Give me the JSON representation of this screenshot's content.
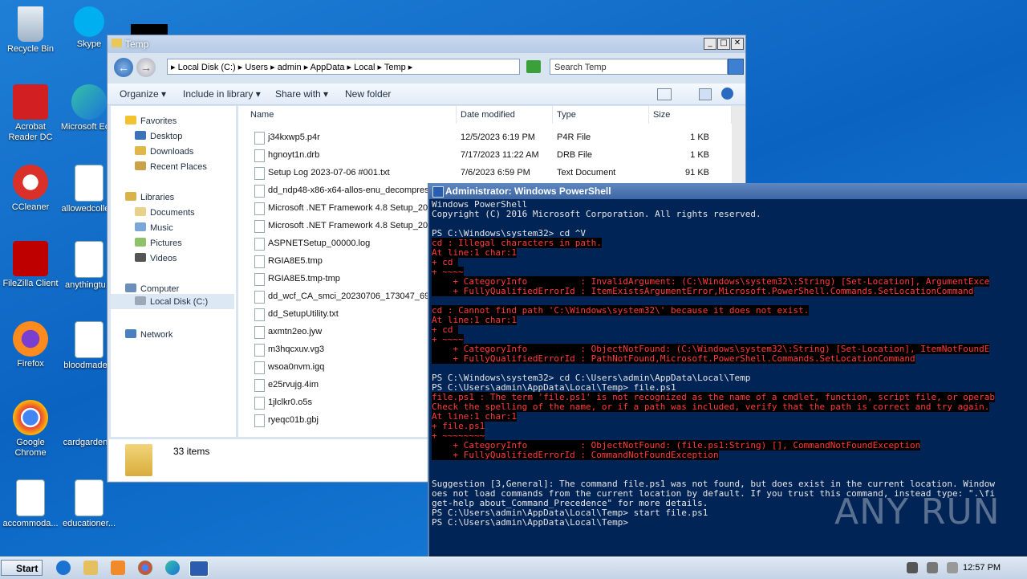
{
  "desktop": {
    "icons": [
      {
        "label": "Recycle Bin"
      },
      {
        "label": "Skype"
      },
      {
        "label": "Acrobat Reader DC"
      },
      {
        "label": "Microsoft Ed..."
      },
      {
        "label": "CCleaner"
      },
      {
        "label": "allowedcolle..."
      },
      {
        "label": "FileZilla Client"
      },
      {
        "label": "anythingtu..."
      },
      {
        "label": "Firefox"
      },
      {
        "label": "bloodmade..."
      },
      {
        "label": "Google Chrome"
      },
      {
        "label": "cardgarden..."
      },
      {
        "label": "accommoda..."
      },
      {
        "label": "educationer..."
      }
    ]
  },
  "explorer": {
    "title": "Temp",
    "address": "▸ Local Disk (C:) ▸ Users ▸ admin ▸ AppData ▸ Local ▸ Temp ▸",
    "search_placeholder": "Search Temp",
    "toolbar": {
      "organize": "Organize ▾",
      "include": "Include in library ▾",
      "share": "Share with ▾",
      "new_folder": "New folder"
    },
    "nav": {
      "favorites": "Favorites",
      "desktop": "Desktop",
      "downloads": "Downloads",
      "recent": "Recent Places",
      "libraries": "Libraries",
      "documents": "Documents",
      "music": "Music",
      "pictures": "Pictures",
      "videos": "Videos",
      "computer": "Computer",
      "localdisk": "Local Disk (C:)",
      "network": "Network"
    },
    "columns": {
      "name": "Name",
      "date": "Date modified",
      "type": "Type",
      "size": "Size"
    },
    "files": [
      {
        "name": "j34kxwp5.p4r",
        "date": "12/5/2023 6:19 PM",
        "type": "P4R File",
        "size": "1 KB"
      },
      {
        "name": "hgnoyt1n.drb",
        "date": "7/17/2023 11:22 AM",
        "type": "DRB File",
        "size": "1 KB"
      },
      {
        "name": "Setup Log 2023-07-06 #001.txt",
        "date": "7/6/2023 6:59 PM",
        "type": "Text Document",
        "size": "91 KB"
      },
      {
        "name": "dd_ndp48-x86-x64-allos-enu_decompres",
        "date": "",
        "type": "",
        "size": ""
      },
      {
        "name": "Microsoft .NET Framework 4.8 Setup_202",
        "date": "",
        "type": "",
        "size": ""
      },
      {
        "name": "Microsoft .NET Framework 4.8 Setup_202",
        "date": "",
        "type": "",
        "size": ""
      },
      {
        "name": "ASPNETSetup_00000.log",
        "date": "",
        "type": "",
        "size": ""
      },
      {
        "name": "RGIA8E5.tmp",
        "date": "",
        "type": "",
        "size": ""
      },
      {
        "name": "RGIA8E5.tmp-tmp",
        "date": "",
        "type": "",
        "size": ""
      },
      {
        "name": "dd_wcf_CA_smci_20230706_173047_693",
        "date": "",
        "type": "",
        "size": ""
      },
      {
        "name": "dd_SetupUtility.txt",
        "date": "",
        "type": "",
        "size": ""
      },
      {
        "name": "axmtn2eo.jyw",
        "date": "",
        "type": "",
        "size": ""
      },
      {
        "name": "m3hqcxuv.vg3",
        "date": "",
        "type": "",
        "size": ""
      },
      {
        "name": "wsoa0nvm.igq",
        "date": "",
        "type": "",
        "size": ""
      },
      {
        "name": "e25rvujg.4im",
        "date": "",
        "type": "",
        "size": ""
      },
      {
        "name": "1jlclkr0.o5s",
        "date": "",
        "type": "",
        "size": ""
      },
      {
        "name": "ryeqc01b.gbj",
        "date": "",
        "type": "",
        "size": ""
      }
    ],
    "item_count": "33 items"
  },
  "powershell": {
    "title": "Administrator: Windows PowerShell",
    "lines": [
      {
        "text": "Windows PowerShell",
        "err": false
      },
      {
        "text": "Copyright (C) 2016 Microsoft Corporation. All rights reserved.",
        "err": false
      },
      {
        "text": "",
        "err": false
      },
      {
        "text": "PS C:\\Windows\\system32> cd ^V",
        "err": false
      },
      {
        "text": "cd : Illegal characters in path.",
        "err": true
      },
      {
        "text": "At line:1 char:1",
        "err": true
      },
      {
        "text": "+ cd ",
        "err": true
      },
      {
        "text": "+ ~~~~",
        "err": true
      },
      {
        "text": "    + CategoryInfo          : InvalidArgument: (C:\\Windows\\system32\\:String) [Set-Location], ArgumentExce",
        "err": true
      },
      {
        "text": "    + FullyQualifiedErrorId : ItemExistsArgumentError,Microsoft.PowerShell.Commands.SetLocationCommand",
        "err": true
      },
      {
        "text": "",
        "err": false
      },
      {
        "text": "cd : Cannot find path 'C:\\Windows\\system32\\' because it does not exist.",
        "err": true
      },
      {
        "text": "At line:1 char:1",
        "err": true
      },
      {
        "text": "+ cd ",
        "err": true
      },
      {
        "text": "+ ~~~~",
        "err": true
      },
      {
        "text": "    + CategoryInfo          : ObjectNotFound: (C:\\Windows\\system32\\:String) [Set-Location], ItemNotFoundE",
        "err": true
      },
      {
        "text": "    + FullyQualifiedErrorId : PathNotFound,Microsoft.PowerShell.Commands.SetLocationCommand",
        "err": true
      },
      {
        "text": "",
        "err": false
      },
      {
        "text": "PS C:\\Windows\\system32> cd C:\\Users\\admin\\AppData\\Local\\Temp",
        "err": false
      },
      {
        "text": "PS C:\\Users\\admin\\AppData\\Local\\Temp> file.ps1",
        "err": false
      },
      {
        "text": "file.ps1 : The term 'file.ps1' is not recognized as the name of a cmdlet, function, script file, or operab",
        "err": true
      },
      {
        "text": "Check the spelling of the name, or if a path was included, verify that the path is correct and try again.",
        "err": true
      },
      {
        "text": "At line:1 char:1",
        "err": true
      },
      {
        "text": "+ file.ps1",
        "err": true
      },
      {
        "text": "+ ~~~~~~~~",
        "err": true
      },
      {
        "text": "    + CategoryInfo          : ObjectNotFound: (file.ps1:String) [], CommandNotFoundException",
        "err": true
      },
      {
        "text": "    + FullyQualifiedErrorId : CommandNotFoundException",
        "err": true
      },
      {
        "text": "",
        "err": false
      },
      {
        "text": "",
        "err": false
      },
      {
        "text": "Suggestion [3,General]: The command file.ps1 was not found, but does exist in the current location. Window",
        "err": false
      },
      {
        "text": "oes not load commands from the current location by default. If you trust this command, instead type: \".\\fi",
        "err": false
      },
      {
        "text": "get-help about_Command_Precedence\" for more details.",
        "err": false
      },
      {
        "text": "PS C:\\Users\\admin\\AppData\\Local\\Temp> start file.ps1",
        "err": false
      },
      {
        "text": "PS C:\\Users\\admin\\AppData\\Local\\Temp>",
        "err": false
      }
    ]
  },
  "watermark": "ANY RUN",
  "taskbar": {
    "start": "Start",
    "clock": "12:57 PM"
  },
  "colors": {
    "ps_bg": "#012456",
    "error_red": "#ff3b3b",
    "desktop_blue": "#0b63c1"
  }
}
